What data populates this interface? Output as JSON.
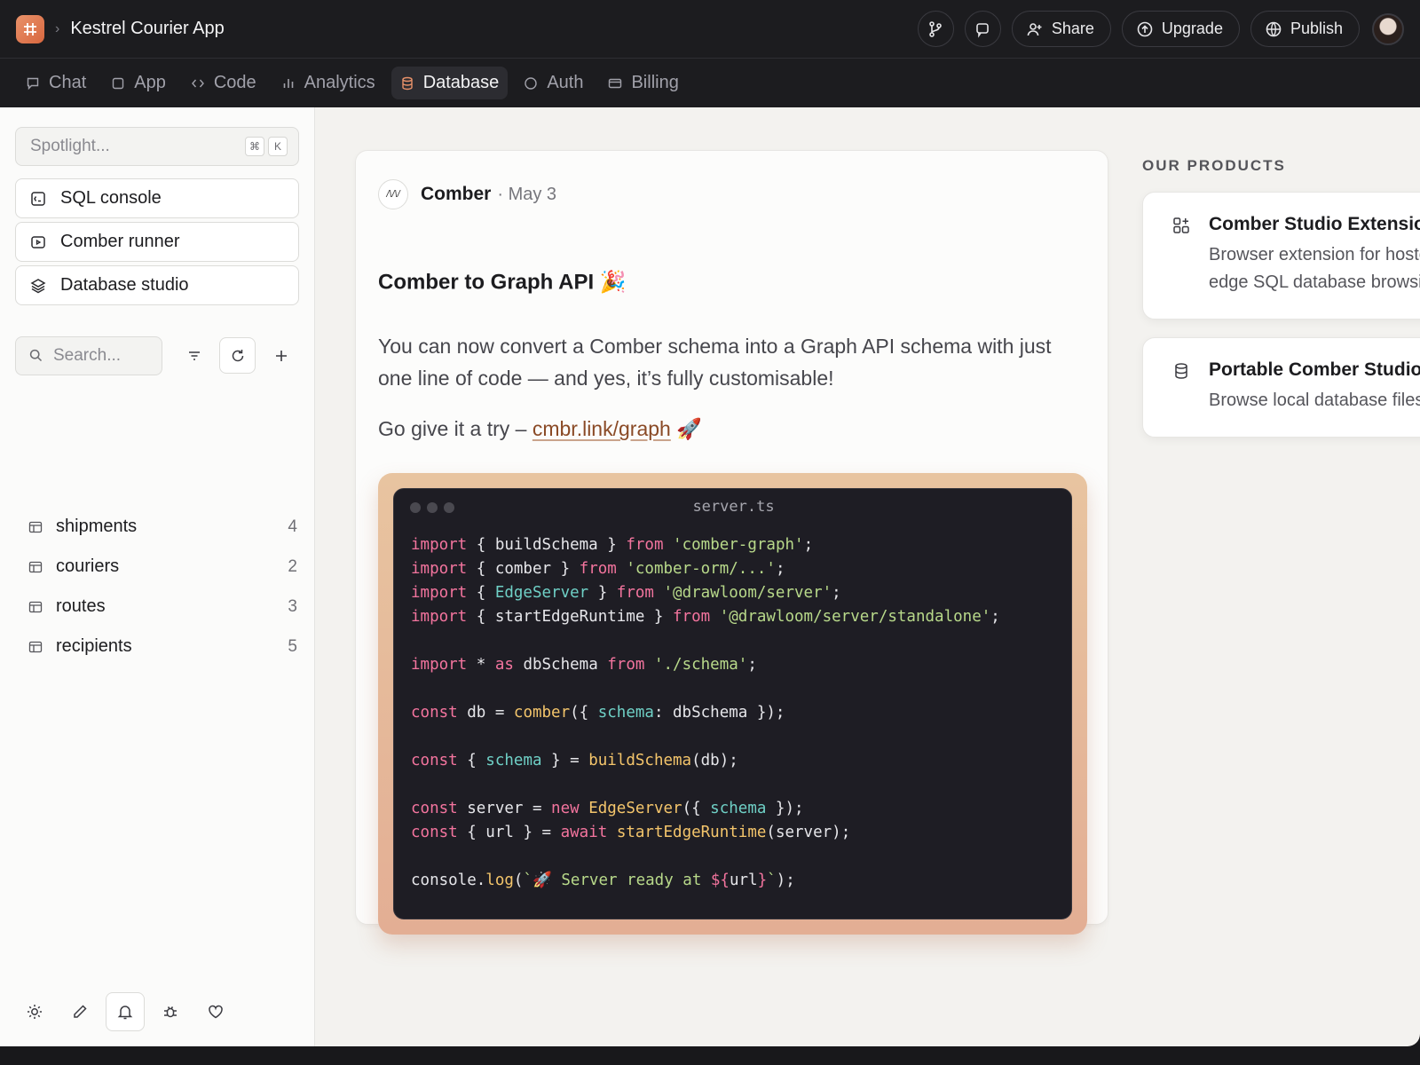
{
  "header": {
    "app_title": "Kestrel Courier App",
    "buttons": {
      "share": "Share",
      "upgrade": "Upgrade",
      "publish": "Publish"
    }
  },
  "tabs": [
    {
      "label": "Chat",
      "icon": "chat-icon"
    },
    {
      "label": "App",
      "icon": "square-icon"
    },
    {
      "label": "Code",
      "icon": "code-icon"
    },
    {
      "label": "Analytics",
      "icon": "bar-chart-icon"
    },
    {
      "label": "Database",
      "icon": "database-icon",
      "active": true
    },
    {
      "label": "Auth",
      "icon": "circle-icon"
    },
    {
      "label": "Billing",
      "icon": "card-icon"
    }
  ],
  "sidebar": {
    "spotlight": {
      "placeholder": "Spotlight...",
      "keys": [
        "⌘",
        "K"
      ]
    },
    "quick_links": [
      "SQL console",
      "Comber runner",
      "Database studio"
    ],
    "search": {
      "placeholder": "Search..."
    },
    "tables": [
      {
        "name": "shipments",
        "count": "4"
      },
      {
        "name": "couriers",
        "count": "2"
      },
      {
        "name": "routes",
        "count": "3"
      },
      {
        "name": "recipients",
        "count": "5"
      }
    ]
  },
  "post": {
    "author_logo_text": "/\\/\\/",
    "author": "Comber",
    "date": "· May 3",
    "title": "Comber to Graph API 🎉",
    "body": "You can now convert a Comber schema into a Graph API schema with just one line of code — and yes, it’s fully customisable!",
    "try_text": "Go give it a try – ",
    "link": "cmbr.link/graph",
    "try_suffix": " 🚀",
    "code_filename": "server.ts"
  },
  "products": {
    "heading": "OUR PRODUCTS",
    "items": [
      {
        "title": "Comber Studio Extension",
        "desc_line1": "Browser extension for hosted",
        "desc_line2": "edge SQL database browsing"
      },
      {
        "title": "Portable Comber Studio",
        "desc_line1": "Browse local database files"
      }
    ]
  },
  "colors": {
    "accent": "#d8673f",
    "keyword": "#f3749e",
    "string": "#b8d98a",
    "function": "#f4c56b",
    "type": "#6fd0c6"
  }
}
